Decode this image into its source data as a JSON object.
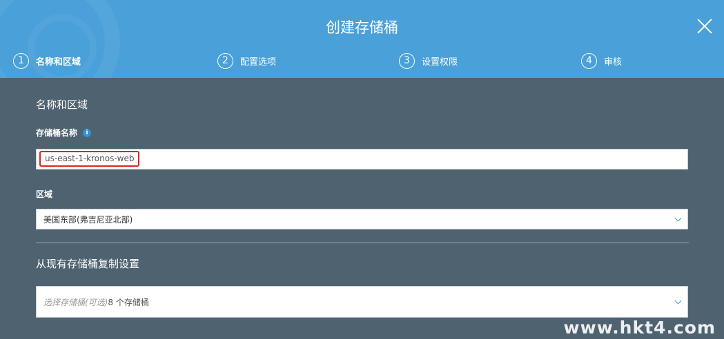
{
  "dialog": {
    "title": "创建存储桶"
  },
  "steps": [
    {
      "number": "1",
      "label": "名称和区域"
    },
    {
      "number": "2",
      "label": "配置选项"
    },
    {
      "number": "3",
      "label": "设置权限"
    },
    {
      "number": "4",
      "label": "审核"
    }
  ],
  "form": {
    "section_title": "名称和区域",
    "bucket_name_label": "存储桶名称",
    "bucket_name_value": "us-east-1-kronos-web",
    "region_label": "区域",
    "region_value": "美国东部(弗吉尼亚北部)",
    "copy_section_title": "从现有存储桶复制设置",
    "copy_placeholder": "选择存储桶(可选)",
    "copy_count": "8 个存储桶"
  },
  "watermark": "www.hkt4.com"
}
